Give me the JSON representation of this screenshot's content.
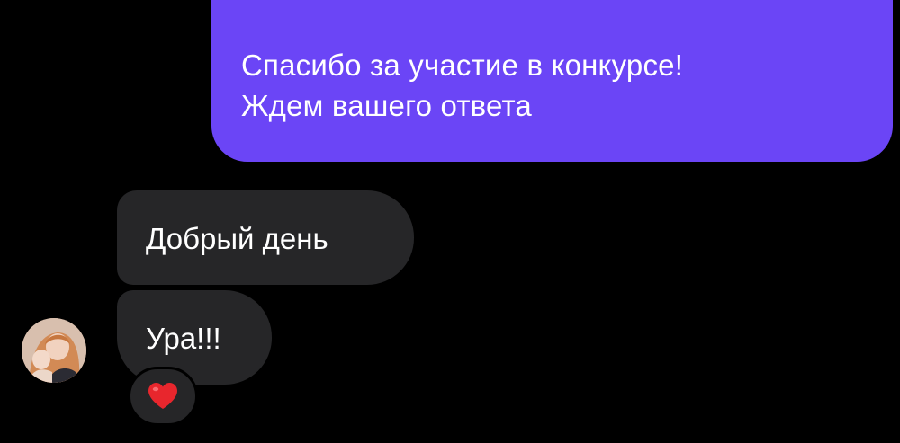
{
  "colors": {
    "background": "#000000",
    "outgoing_bubble": "#6b45f6",
    "incoming_bubble": "#262628",
    "text": "#ffffff",
    "heart": "#e8262d"
  },
  "outgoing_message": {
    "lines": [
      "Спасибо за участие в конкурсе!",
      "Ждем вашего ответа"
    ]
  },
  "incoming_messages": [
    {
      "text": "Добрый день"
    },
    {
      "text": "Ура!!!"
    }
  ],
  "reaction": {
    "icon": "red-heart-icon"
  },
  "avatar": {
    "icon": "user-avatar-photo"
  }
}
